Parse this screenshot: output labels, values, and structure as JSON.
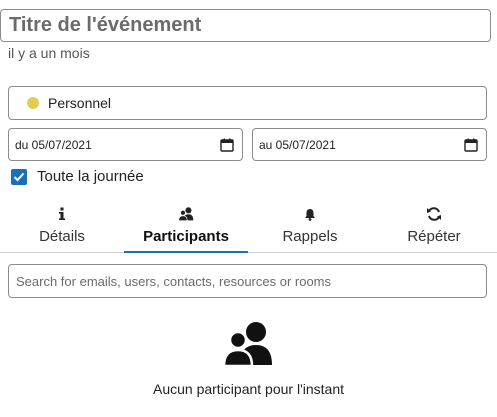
{
  "event": {
    "title_placeholder": "Titre de l'événement",
    "timestamp": "il y a un mois"
  },
  "calendar": {
    "name": "Personnel",
    "color": "#e3cd50"
  },
  "dates": {
    "start": "du 05/07/2021",
    "end": "au 05/07/2021"
  },
  "all_day": {
    "label": "Toute la journée",
    "checked": true
  },
  "tabs": [
    {
      "label": "Détails",
      "icon": "info-icon"
    },
    {
      "label": "Participants",
      "icon": "people-icon",
      "active": true
    },
    {
      "label": "Rappels",
      "icon": "bell-icon"
    },
    {
      "label": "Répéter",
      "icon": "repeat-icon"
    }
  ],
  "participants": {
    "search_placeholder": "Search for emails, users, contacts, resources or rooms",
    "empty_icon": "people-icon",
    "empty_text": "Aucun participant pour l'instant"
  },
  "colors": {
    "accent": "#1a6fba"
  }
}
